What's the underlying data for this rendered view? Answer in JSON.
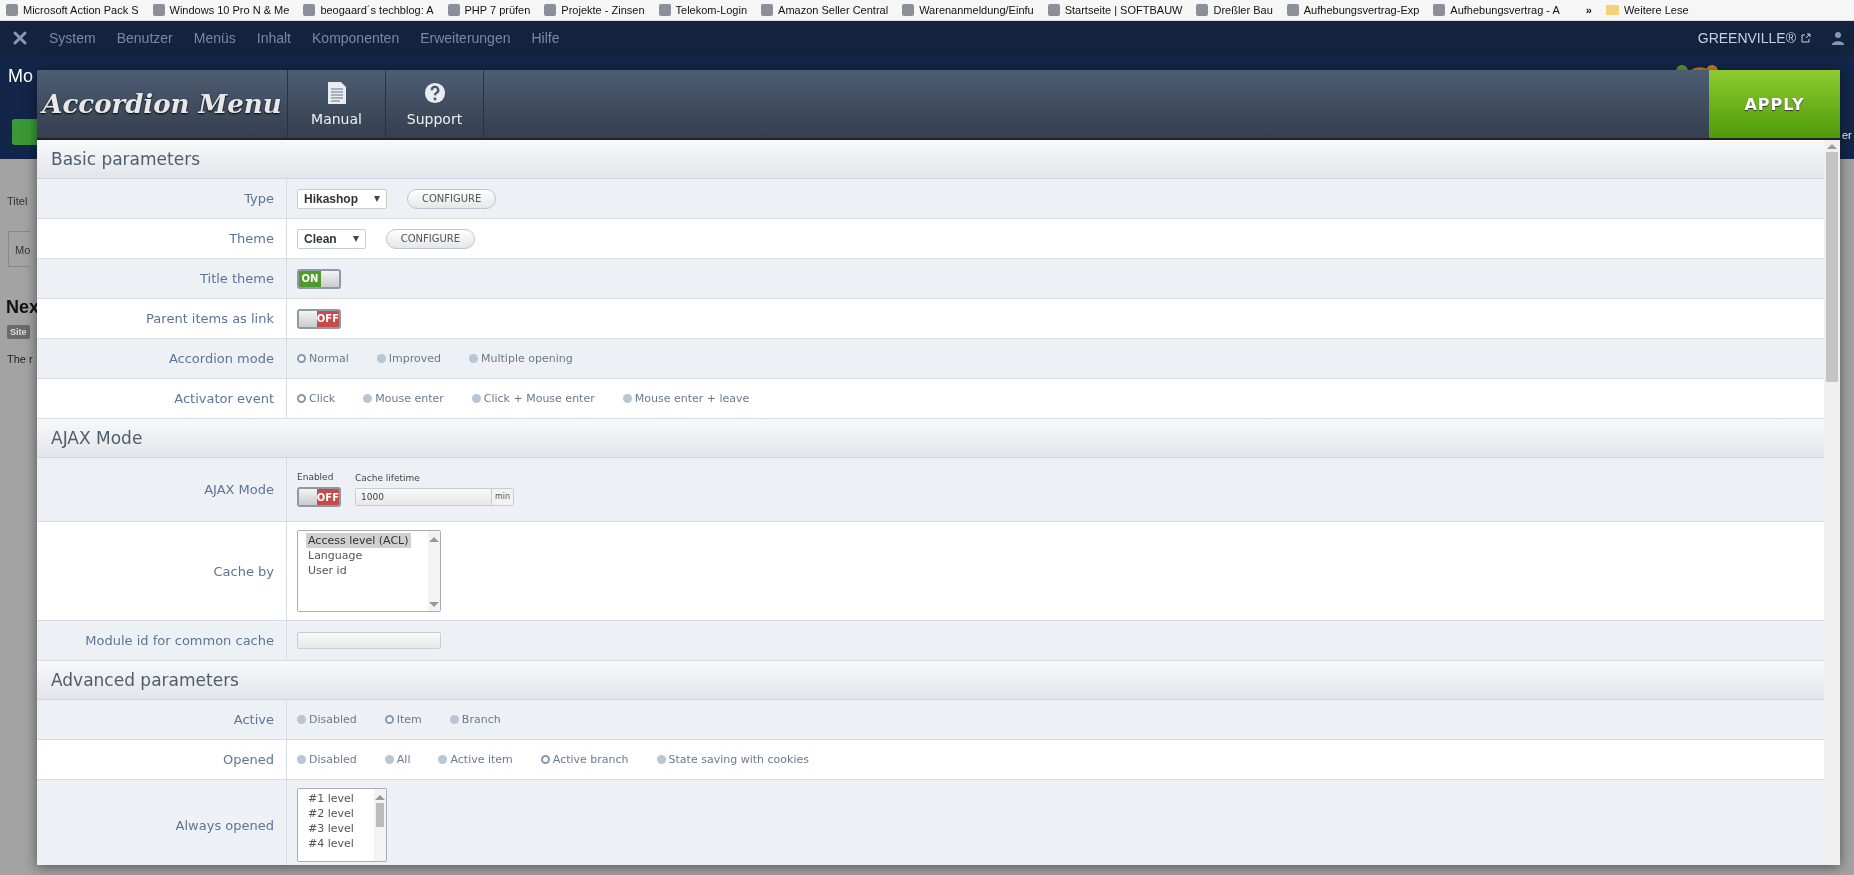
{
  "bookmarks": [
    {
      "label": "Microsoft Action Pack S"
    },
    {
      "label": "Windows 10 Pro N & Me"
    },
    {
      "label": "beogaard´s techblog: A"
    },
    {
      "label": "PHP 7 prüfen"
    },
    {
      "label": "Projekte - Zinsen"
    },
    {
      "label": "Telekom-Login"
    },
    {
      "label": "Amazon Seller Central"
    },
    {
      "label": "Warenanmeldung/Einfu"
    },
    {
      "label": "Startseite | SOFTBAUW"
    },
    {
      "label": "Dreßler Bau"
    },
    {
      "label": "Aufhebungsvertrag-Exp"
    },
    {
      "label": "Aufhebungsvertrag - A"
    }
  ],
  "bookmarks_more": "»",
  "bookmarks_folder": "Weitere Lese",
  "admin_menu": [
    "System",
    "Benutzer",
    "Menüs",
    "Inhalt",
    "Komponenten",
    "Erweiterungen",
    "Hilfe"
  ],
  "admin_site": "GREENVILLE®",
  "background_page": {
    "title": "Mo",
    "field_label": "Titel",
    "tab": "Mo",
    "heading": "Nex",
    "badge": "Site",
    "text": "The r",
    "right_text": "er"
  },
  "modal": {
    "title": "Accordion Menu",
    "tools": [
      {
        "label": "Manual",
        "kind": "manual"
      },
      {
        "label": "Support",
        "kind": "support"
      }
    ],
    "apply": "APPLY",
    "sections": [
      {
        "title": "Basic parameters",
        "rows": [
          {
            "label": "Type",
            "kind": "select",
            "value": "Hikashop",
            "button": "CONFIGURE"
          },
          {
            "label": "Theme",
            "kind": "select",
            "value": "Clean",
            "button": "CONFIGURE"
          },
          {
            "label": "Title theme",
            "kind": "toggle",
            "on": true,
            "text": "ON"
          },
          {
            "label": "Parent items as link",
            "kind": "toggle",
            "on": false,
            "text": "OFF"
          },
          {
            "label": "Accordion mode",
            "kind": "radio",
            "options": [
              {
                "label": "Normal",
                "selected": true
              },
              {
                "label": "Improved",
                "selected": false
              },
              {
                "label": "Multiple opening",
                "selected": false
              }
            ]
          },
          {
            "label": "Activator event",
            "kind": "radio",
            "options": [
              {
                "label": "Click",
                "selected": true
              },
              {
                "label": "Mouse enter",
                "selected": false
              },
              {
                "label": "Click + Mouse enter",
                "selected": false
              },
              {
                "label": "Mouse enter + leave",
                "selected": false
              }
            ]
          }
        ]
      },
      {
        "title": "AJAX Mode",
        "rows": [
          {
            "label": "AJAX Mode",
            "kind": "ajax",
            "toggle_caption": "Enabled",
            "on": false,
            "text": "OFF",
            "input_caption": "Cache lifetime",
            "value": "1000",
            "unit": "min"
          },
          {
            "label": "Cache by",
            "kind": "listbox",
            "options": [
              {
                "label": "Access level (ACL)",
                "selected": true
              },
              {
                "label": "Language",
                "selected": false
              },
              {
                "label": "User id",
                "selected": false
              }
            ]
          },
          {
            "label": "Module id for common cache",
            "kind": "text"
          }
        ]
      },
      {
        "title": "Advanced parameters",
        "rows": [
          {
            "label": "Active",
            "kind": "radio",
            "options": [
              {
                "label": "Disabled",
                "selected": false
              },
              {
                "label": "Item",
                "selected": true
              },
              {
                "label": "Branch",
                "selected": false
              }
            ]
          },
          {
            "label": "Opened",
            "kind": "radio",
            "options": [
              {
                "label": "Disabled",
                "selected": false
              },
              {
                "label": "All",
                "selected": false
              },
              {
                "label": "Active item",
                "selected": false
              },
              {
                "label": "Active branch",
                "selected": true
              },
              {
                "label": "State saving with cookies",
                "selected": false
              }
            ]
          },
          {
            "label": "Always opened",
            "kind": "levels",
            "options": [
              {
                "label": "#1 level",
                "selected": false
              },
              {
                "label": "#2 level",
                "selected": false
              },
              {
                "label": "#3 level",
                "selected": false
              },
              {
                "label": "#4 level",
                "selected": false
              }
            ]
          }
        ]
      }
    ]
  }
}
